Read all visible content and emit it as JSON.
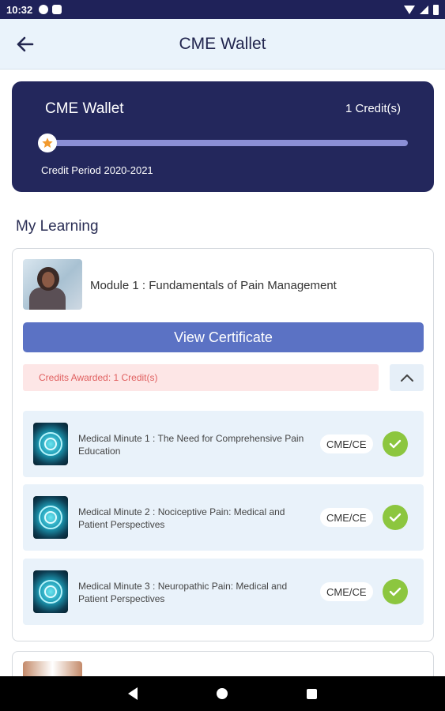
{
  "status_bar": {
    "time": "10:32"
  },
  "app_bar": {
    "title": "CME Wallet"
  },
  "wallet": {
    "title": "CME Wallet",
    "credits": "1 Credit(s)",
    "progress": 0.0,
    "period": "Credit Period 2020-2021"
  },
  "section": {
    "title": "My Learning"
  },
  "module": {
    "title": "Module 1 : Fundamentals of Pain Management",
    "view_certificate_label": "View Certificate",
    "credits_awarded": "Credits Awarded: 1 Credit(s)",
    "items": [
      {
        "title": "Medical Minute 1 : The Need for Comprehensive Pain Education",
        "badge": "CME/CE",
        "completed": true
      },
      {
        "title": "Medical Minute 2 : Nociceptive Pain: Medical and Patient Perspectives",
        "badge": "CME/CE",
        "completed": true
      },
      {
        "title": "Medical Minute 3 : Neuropathic Pain: Medical and Patient Perspectives",
        "badge": "CME/CE",
        "completed": true
      }
    ]
  },
  "colors": {
    "wallet_bg": "#23275c",
    "button_primary": "#5b72c4",
    "check_green": "#8cc63f",
    "credits_text": "#e06060"
  }
}
